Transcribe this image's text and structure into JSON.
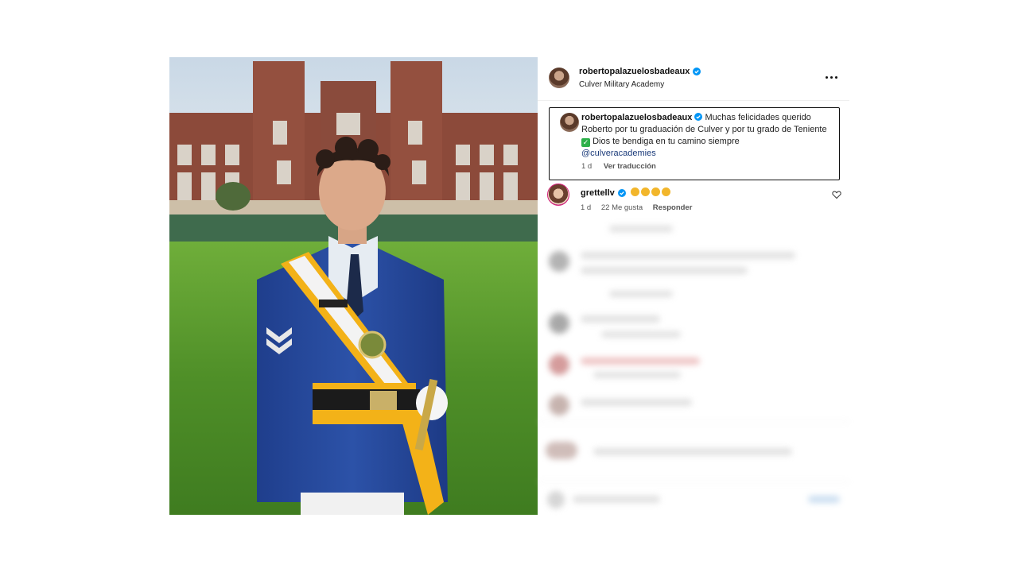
{
  "post": {
    "owner": {
      "username": "robertopalazuelosbadeaux",
      "location": "Culver Military Academy"
    },
    "caption": {
      "username": "robertopalazuelosbadeaux",
      "text_part1": "Muchas felicidades querido Roberto por tu graduación de Culver y por tu grado de Teniente",
      "text_part2": "Dios te bendiga en tu camino siempre",
      "mention": "@culveracademies",
      "time": "1 d",
      "translate_label": "Ver traducción"
    },
    "comments": [
      {
        "username": "grettellv",
        "time": "1 d",
        "likes": "22 Me gusta",
        "reply_label": "Responder"
      }
    ]
  },
  "icons": {
    "verified": "verified-badge-icon",
    "more": "more-options-icon",
    "heart": "heart-icon",
    "emoji_check": "check-mark-emoji",
    "emoji_clap": "clapping-hands-emoji"
  },
  "colors": {
    "verified_blue": "#0095f6",
    "mention": "#1b3b7a",
    "story_ring": "#d4217a"
  }
}
